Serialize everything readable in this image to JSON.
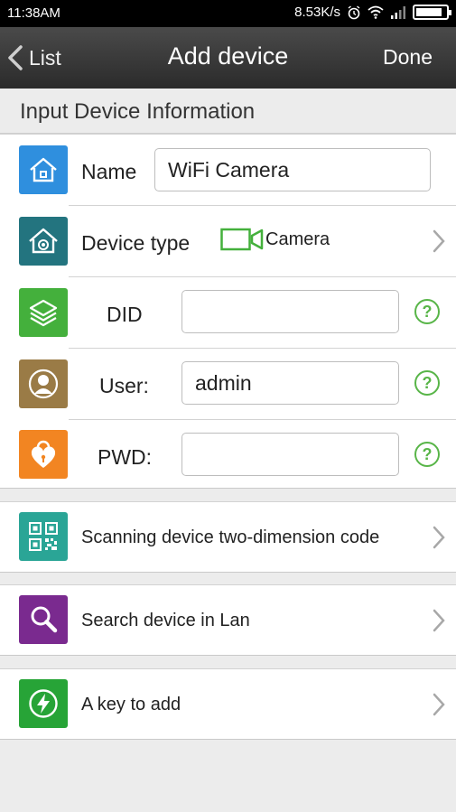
{
  "status_bar": {
    "time": "11:38AM",
    "net_speed": "8.53K/s",
    "battery_level_percent": 90,
    "icons": [
      "alarm-icon",
      "wifi-icon",
      "signal-icon",
      "battery-icon"
    ]
  },
  "nav": {
    "back_label": "List",
    "title": "Add device",
    "done_label": "Done"
  },
  "section": {
    "title": "Input Device Information"
  },
  "form": {
    "name_label": "Name",
    "name_value": "WiFi Camera",
    "device_type_label": "Device type",
    "device_type_value": "Camera",
    "did_label": "DID",
    "did_value": "",
    "user_label": "User:",
    "user_value": "admin",
    "pwd_label": "PWD:",
    "pwd_value": "",
    "help_glyph": "?"
  },
  "options": {
    "scan_label": "Scanning device two-dimension code",
    "search_label": "Search device in Lan",
    "onekey_label": "A key to add"
  },
  "colors": {
    "blue": "#2f8fde",
    "teal": "#23747f",
    "green": "#44b03c",
    "brown": "#9a7b46",
    "orange": "#f28522",
    "qr_teal": "#2aa596",
    "purple": "#7a2a8f",
    "bolt_green": "#27a437",
    "help_green": "#58b548"
  }
}
